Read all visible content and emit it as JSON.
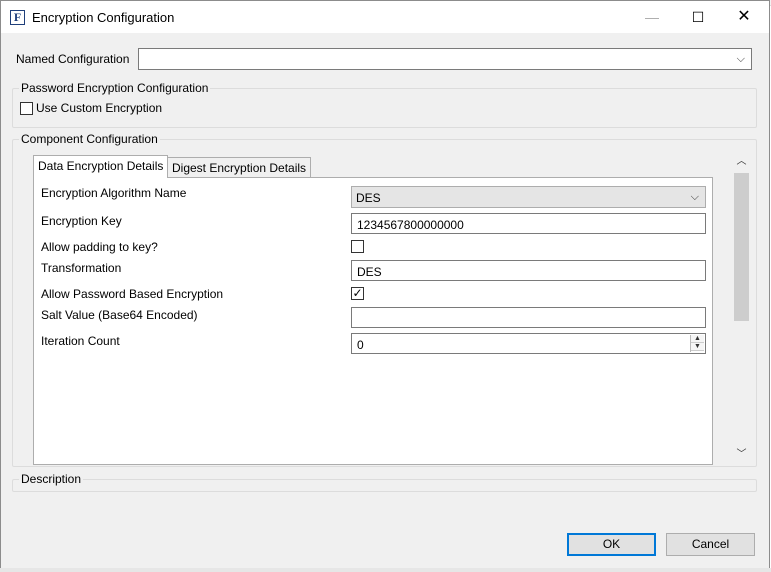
{
  "window": {
    "title": "Encryption Configuration",
    "app_icon": "F",
    "buttons": {
      "minimize": "—",
      "maximize": "☐",
      "close": "✕"
    }
  },
  "named_configuration": {
    "label": "Named Configuration",
    "value": ""
  },
  "password_group": {
    "title": "Password Encryption Configuration",
    "use_custom_label": "Use Custom Encryption",
    "use_custom_checked": false
  },
  "component_group": {
    "title": "Component Configuration",
    "tabs": [
      {
        "label": "Data Encryption Details",
        "active": true
      },
      {
        "label": "Digest Encryption Details",
        "active": false
      }
    ],
    "fields": {
      "algorithm_label": "Encryption Algorithm Name",
      "algorithm_value": "DES",
      "key_label": "Encryption Key",
      "key_value": "1234567800000000",
      "padding_label": "Allow padding to key?",
      "padding_checked": false,
      "transformation_label": "Transformation",
      "transformation_value": "DES",
      "pbe_label": "Allow Password Based Encryption",
      "pbe_checked": true,
      "salt_label": "Salt Value (Base64 Encoded)",
      "salt_value": "",
      "iteration_label": "Iteration Count",
      "iteration_value": "0"
    }
  },
  "description_group": {
    "title": "Description"
  },
  "footer": {
    "ok_label": "OK",
    "cancel_label": "Cancel"
  },
  "icons": {
    "dropdown": "⌵",
    "check": "✓",
    "scroll_up": "︿",
    "scroll_down": "﹀",
    "spin_up": "▲",
    "spin_down": "▼"
  }
}
